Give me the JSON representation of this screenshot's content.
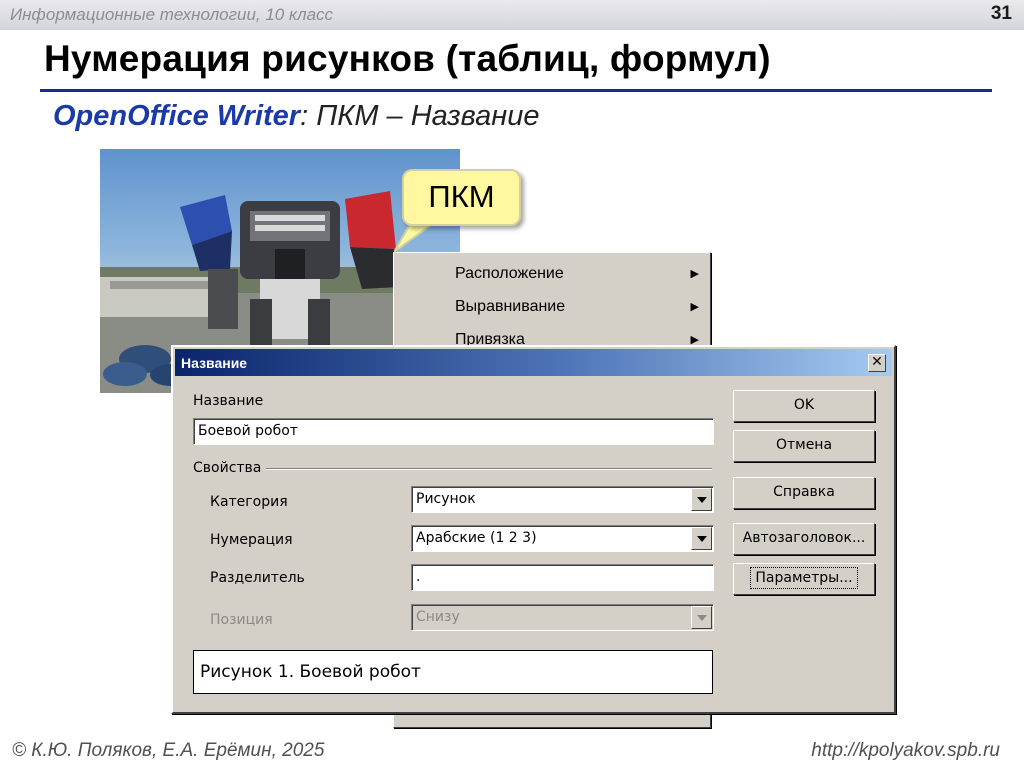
{
  "header": {
    "course": "Информационные технологии, 10 класс",
    "slide_number": "31"
  },
  "title": "Нумерация рисунков (таблиц, формул)",
  "subtitle": {
    "app": "OpenOffice Writer",
    "rest": ": ПКМ – Название"
  },
  "callout": {
    "text": "ПКМ"
  },
  "context_menu": {
    "items": [
      {
        "label": "Расположение"
      },
      {
        "label": "Выравнивание"
      },
      {
        "label": "Привязка"
      }
    ]
  },
  "dialog": {
    "title": "Название",
    "close_label": "✕",
    "name_label": "Название",
    "name_value": "Боевой робот",
    "properties_label": "Свойства",
    "category_label": "Категория",
    "category_value": "Рисунок",
    "numbering_label": "Нумерация",
    "numbering_value": "Арабские (1 2 3)",
    "separator_label": "Разделитель",
    "separator_value": ".",
    "position_label": "Позиция",
    "position_value": "Снизу",
    "preview_text": "Рисунок 1. Боевой робот",
    "buttons": {
      "ok": "OK",
      "cancel": "Отмена",
      "help": "Справка",
      "autocaption": "Автозаголовок...",
      "options": "Параметры..."
    }
  },
  "footer": {
    "left": "© К.Ю. Поляков, Е.А. Ерёмин, 2025",
    "right": "http://kpolyakov.spb.ru"
  },
  "colors": {
    "accent": "#1c2b8e",
    "callout": "#fff8a0",
    "dialog_face": "#d4d0c8",
    "titlebar": "#0a246a"
  },
  "icons": [
    "arrow-right-icon",
    "close-icon",
    "dropdown-arrow-icon"
  ]
}
